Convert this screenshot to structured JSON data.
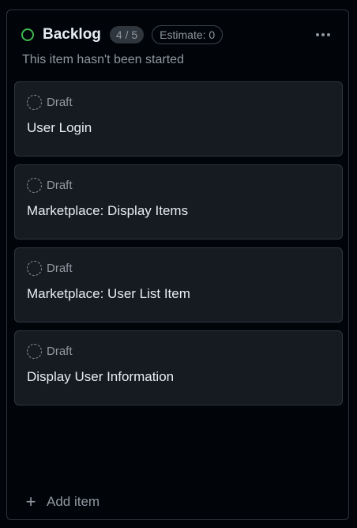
{
  "column": {
    "title": "Backlog",
    "count": "4 / 5",
    "estimate": "Estimate: 0",
    "description": "This item hasn't been started",
    "status_color": "#3fb950",
    "more_icon": "kebab-horizontal-icon"
  },
  "cards": [
    {
      "status": "Draft",
      "title": "User Login",
      "status_icon": "draft-issue-icon"
    },
    {
      "status": "Draft",
      "title": "Marketplace: Display Items",
      "status_icon": "draft-issue-icon"
    },
    {
      "status": "Draft",
      "title": "Marketplace: User List Item",
      "status_icon": "draft-issue-icon"
    },
    {
      "status": "Draft",
      "title": "Display User Information",
      "status_icon": "draft-issue-icon"
    }
  ],
  "footer": {
    "add_label": "Add item",
    "add_icon": "plus-icon"
  }
}
